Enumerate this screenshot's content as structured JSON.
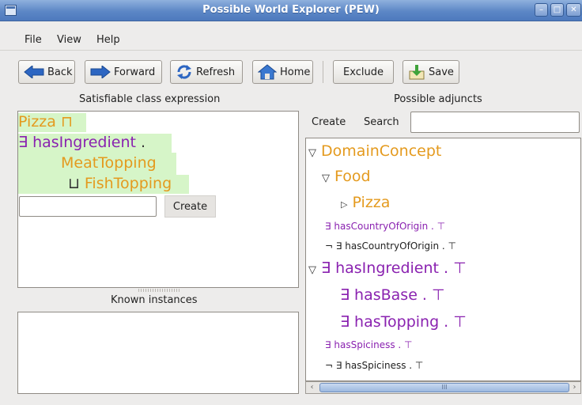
{
  "window": {
    "title": "Possible World Explorer (PEW)"
  },
  "menu": {
    "file": "File",
    "view": "View",
    "help": "Help"
  },
  "toolbar": {
    "back": "Back",
    "forward": "Forward",
    "refresh": "Refresh",
    "home": "Home",
    "exclude": "Exclude",
    "save": "Save"
  },
  "left": {
    "header": "Satisfiable class expression",
    "expr": {
      "pizza": "Pizza",
      "and_op": "⊓",
      "exists": "∃",
      "has_ingredient": "hasIngredient",
      "dot": ".",
      "meat": "MeatTopping",
      "or_op": "⊔",
      "fish": "FishTopping"
    },
    "create_input_value": "",
    "create_label": "Create",
    "instances_header": "Known instances"
  },
  "right": {
    "header": "Possible adjuncts",
    "create_label": "Create",
    "search_label": "Search",
    "search_value": "",
    "tree": [
      {
        "label": "DomainConcept",
        "expanded": true
      },
      {
        "label": "Food",
        "expanded": true
      },
      {
        "label": "Pizza",
        "expanded": false
      },
      {
        "label": "∃ hasCountryOfOrigin . ⊤"
      },
      {
        "label": "¬  ∃ hasCountryOfOrigin . ⊤"
      },
      {
        "label": "∃ hasIngredient . ⊤",
        "expanded": true
      },
      {
        "label": "∃ hasBase . ⊤"
      },
      {
        "label": "∃ hasTopping . ⊤"
      },
      {
        "label": "∃ hasSpiciness . ⊤"
      },
      {
        "label": "¬  ∃ hasSpiciness . ⊤"
      }
    ],
    "scroll_thumb": "III"
  },
  "colors": {
    "concept": "#e49a1e",
    "role": "#8a22b0",
    "highlight": "#d6f5c8",
    "titlebar": "#5c87c6"
  },
  "icons": [
    "back-arrow-icon",
    "forward-arrow-icon",
    "refresh-icon",
    "home-icon",
    "save-icon"
  ]
}
